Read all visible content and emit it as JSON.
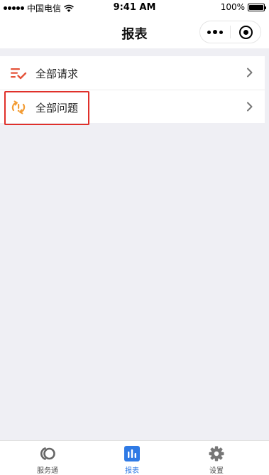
{
  "status_bar": {
    "carrier": "中国电信",
    "time": "9:41 AM",
    "battery": "100%",
    "battery_level": 1.0
  },
  "nav": {
    "title": "报表",
    "more_icon": "more-dots-icon",
    "close_icon": "target-close-icon"
  },
  "list": {
    "items": [
      {
        "label": "全部请求",
        "icon": "request-list-icon"
      },
      {
        "label": "全部问题",
        "icon": "problem-refresh-icon"
      }
    ]
  },
  "tabs": [
    {
      "label": "服务通",
      "icon": "service-icon",
      "active": false
    },
    {
      "label": "报表",
      "icon": "report-icon",
      "active": true
    },
    {
      "label": "设置",
      "icon": "gear-icon",
      "active": false
    }
  ],
  "colors": {
    "accent": "#2f7ae5",
    "icon_red": "#e5533a",
    "icon_orange": "#f39c34",
    "highlight": "#e0302a"
  }
}
